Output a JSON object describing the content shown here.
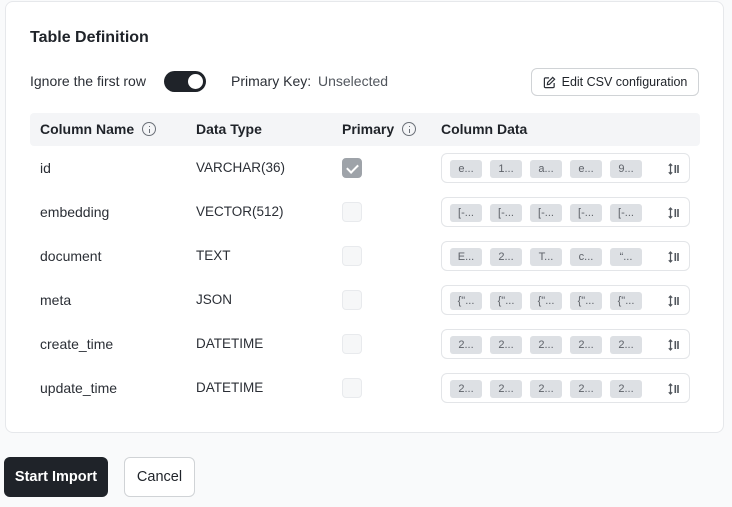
{
  "panel": {
    "title": "Table Definition",
    "ignore_first_row_label": "Ignore the first row",
    "ignore_first_row_enabled": true,
    "primary_key_label": "Primary Key:",
    "primary_key_value": "Unselected",
    "edit_csv_label": "Edit CSV configuration"
  },
  "table": {
    "headers": {
      "column_name": "Column Name",
      "data_type": "Data Type",
      "primary": "Primary",
      "column_data": "Column Data"
    },
    "rows": [
      {
        "name": "id",
        "type": "VARCHAR(36)",
        "primary": true,
        "samples": [
          "e...",
          "1...",
          "a...",
          "e...",
          "9..."
        ]
      },
      {
        "name": "embedding",
        "type": "VECTOR(512)",
        "primary": false,
        "samples": [
          "[-...",
          "[-...",
          "[-...",
          "[-...",
          "[-..."
        ]
      },
      {
        "name": "document",
        "type": "TEXT",
        "primary": false,
        "samples": [
          "E...",
          "2...",
          "T...",
          "c...",
          "“..."
        ]
      },
      {
        "name": "meta",
        "type": "JSON",
        "primary": false,
        "samples": [
          "{\"...",
          "{\"...",
          "{\"...",
          "{\"...",
          "{\"..."
        ]
      },
      {
        "name": "create_time",
        "type": "DATETIME",
        "primary": false,
        "samples": [
          "2...",
          "2...",
          "2...",
          "2...",
          "2..."
        ]
      },
      {
        "name": "update_time",
        "type": "DATETIME",
        "primary": false,
        "samples": [
          "2...",
          "2...",
          "2...",
          "2...",
          "2..."
        ]
      }
    ]
  },
  "actions": {
    "start_import_label": "Start Import",
    "cancel_label": "Cancel"
  },
  "colors": {
    "primary_dark": "#1f2329",
    "chip_bg": "#dde0e4",
    "checked_bg": "#9ea3a9"
  },
  "icons": {
    "edit": "edit-square-pen-icon",
    "info": "info-circle-icon",
    "sort": "sort-arrows-icon"
  }
}
